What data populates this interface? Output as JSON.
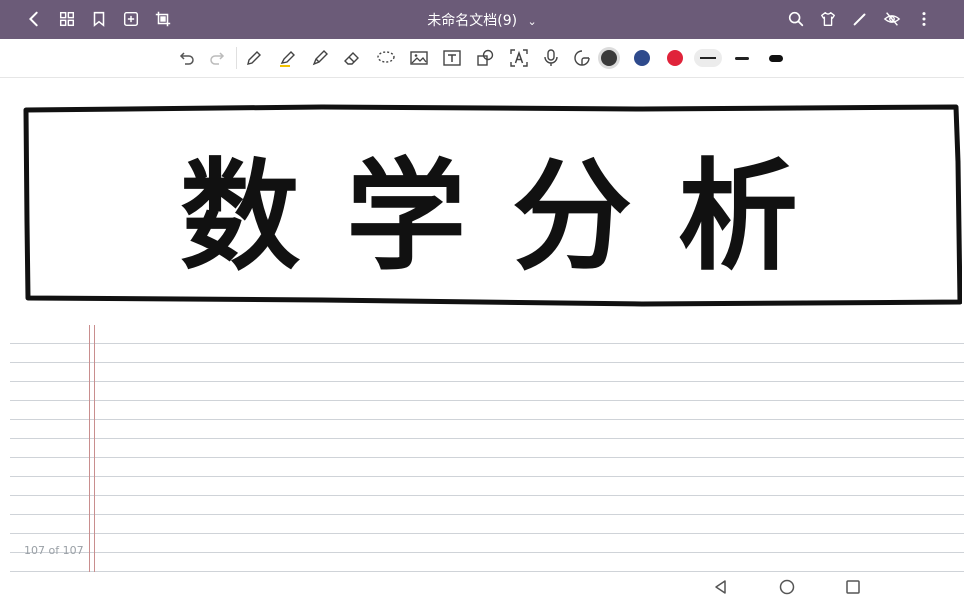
{
  "app": {
    "document_title": "未命名文档(9)"
  },
  "topbar": {
    "left_icons": [
      "back-icon",
      "grid-icon",
      "bookmark-icon",
      "add-page-icon",
      "crop-icon"
    ],
    "right_icons": [
      "search-icon",
      "theme-shirt-icon",
      "pen-icon",
      "eye-off-icon",
      "more-vertical-icon"
    ]
  },
  "toolbar": {
    "tools": [
      "undo-icon",
      "redo-icon",
      "pen-tool-icon",
      "highlighter-icon",
      "marker-icon",
      "eraser-icon",
      "lasso-icon",
      "image-icon",
      "text-box-icon",
      "shape-icon",
      "ocr-text-icon",
      "microphone-icon",
      "sticker-icon"
    ],
    "colors": [
      "#3a3a3a",
      "#2e4a8c",
      "#e0233a"
    ],
    "stroke_widths": [
      "thin",
      "medium",
      "thick"
    ]
  },
  "canvas": {
    "banner_text": "数学分析",
    "page_counter": "107 of 107"
  },
  "navbar": {
    "buttons": [
      "back-triangle-icon",
      "home-circle-icon",
      "recents-square-icon"
    ]
  }
}
